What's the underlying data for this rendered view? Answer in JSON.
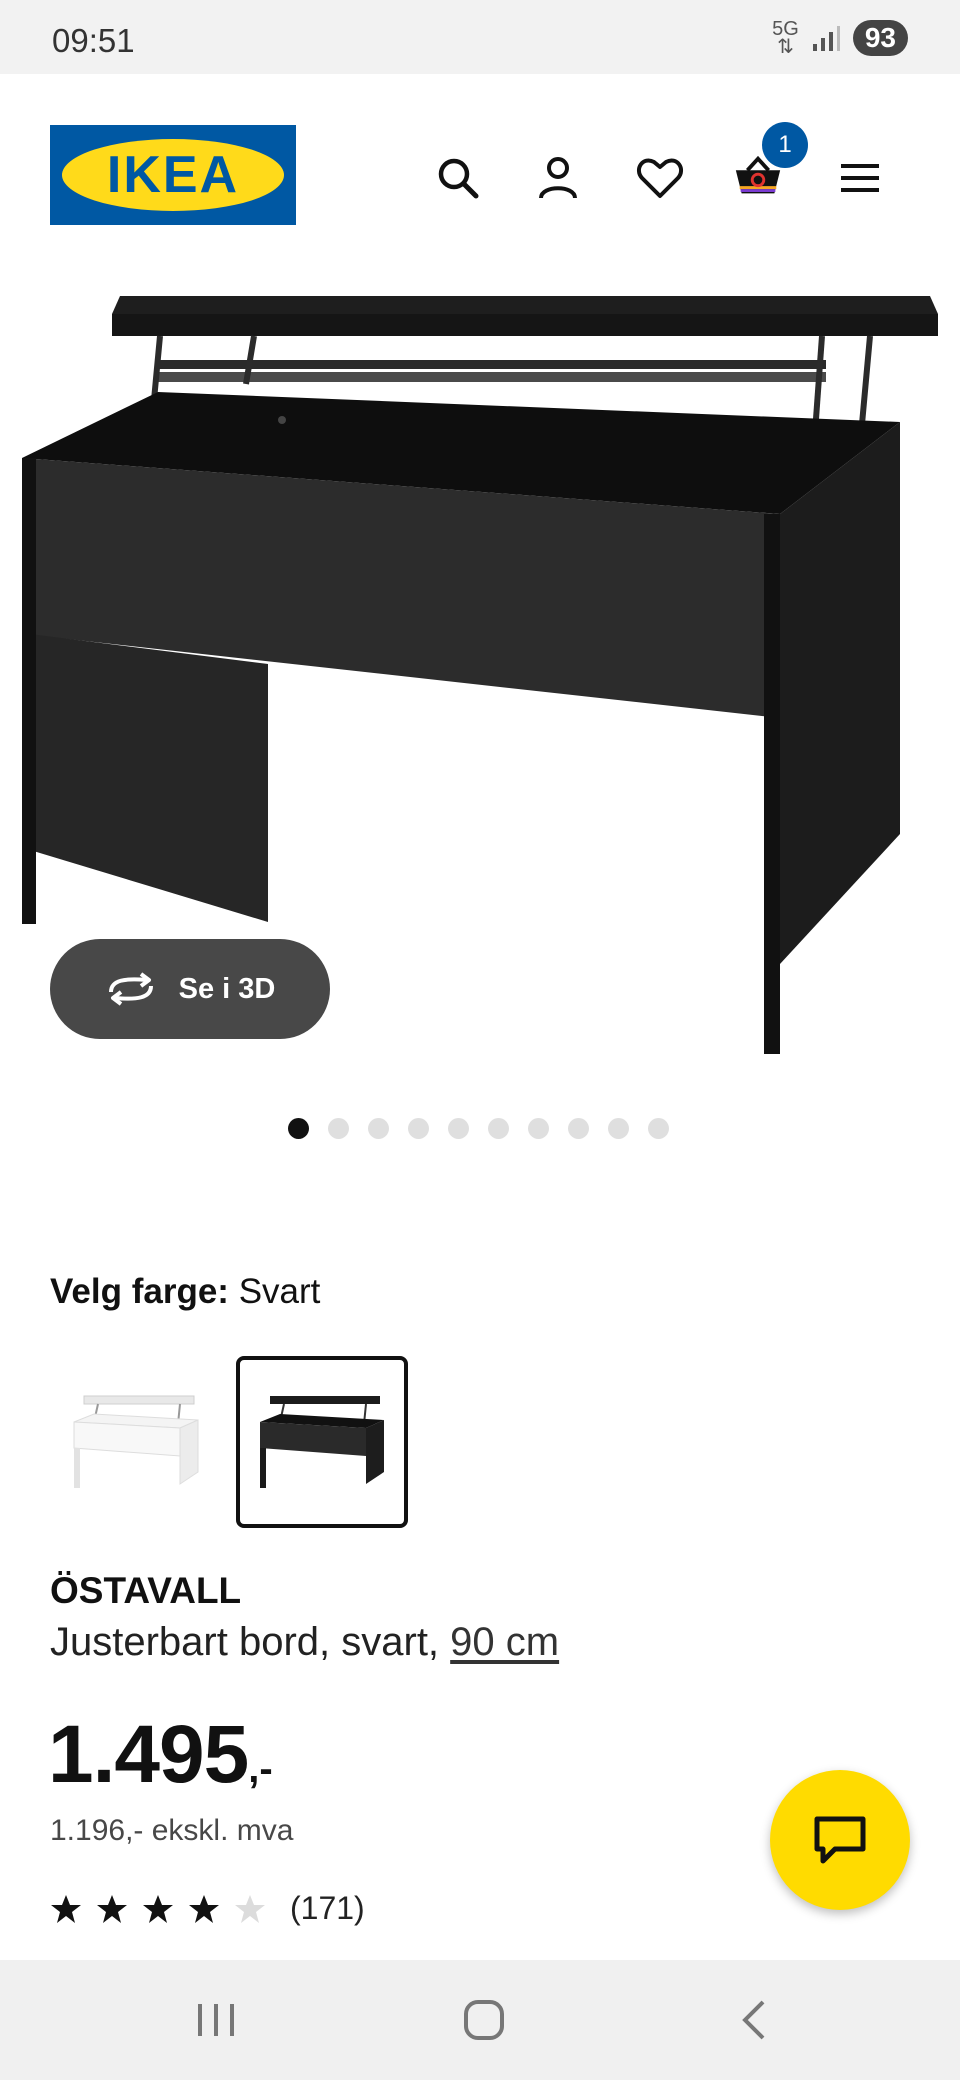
{
  "status": {
    "time": "09:51",
    "network": "5G",
    "battery": "93"
  },
  "header": {
    "logo_text": "IKEA",
    "icons": [
      "search-icon",
      "account-icon",
      "favorite-icon",
      "cart-icon",
      "menu-icon"
    ],
    "cart_count": "1"
  },
  "gallery": {
    "view_3d_label": "Se i 3D",
    "total_images": 10,
    "active_index": 0
  },
  "color": {
    "label": "Velg farge:",
    "value": "Svart",
    "options": [
      "white",
      "black"
    ],
    "selected": "black"
  },
  "product": {
    "name": "ÖSTAVALL",
    "description": "Justerbart bord, svart,",
    "size_link": "90 cm",
    "price": "1.495",
    "price_suffix": ",-",
    "price_ex_vat": "1.196,- ekskl. mva",
    "rating_value": 4,
    "rating_max": 5,
    "rating_count": "(171)"
  },
  "colors": {
    "ikea_blue": "#0058a3",
    "ikea_yellow": "#ffda1a",
    "fab_yellow": "#ffdb00"
  }
}
